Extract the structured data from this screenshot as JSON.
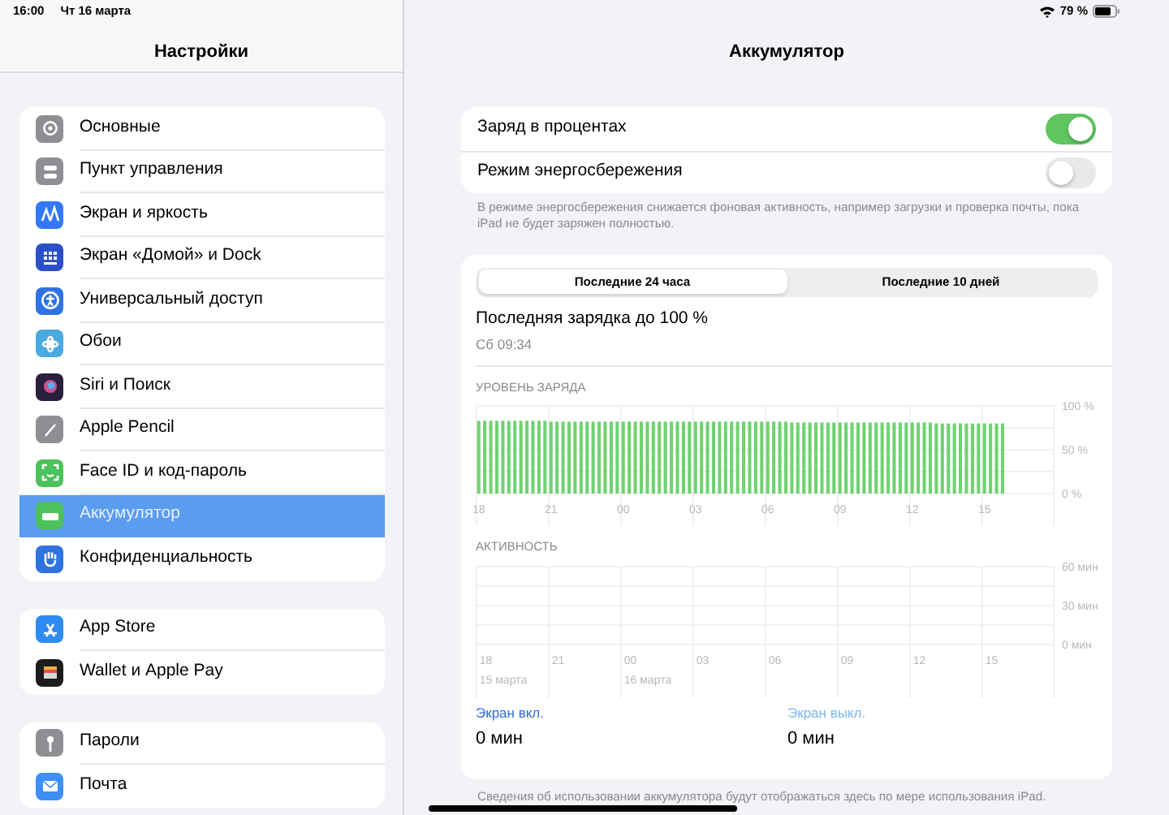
{
  "status_bar": {
    "time": "16:00",
    "date": "Чт 16 марта",
    "battery_percent": "79 %"
  },
  "sidebar": {
    "title": "Настройки",
    "groups": [
      {
        "items": [
          {
            "label": "Основные",
            "color": "#8e8e93",
            "selected": false
          },
          {
            "label": "Пункт управления",
            "color": "#8e8e93",
            "selected": false
          },
          {
            "label": "Экран и яркость",
            "color": "#3478f6",
            "selected": false
          },
          {
            "label": "Экран «Домой» и Dock",
            "color": "#2c4fc9",
            "selected": false
          },
          {
            "label": "Универсальный доступ",
            "color": "#2f73e0",
            "selected": false
          },
          {
            "label": "Обои",
            "color": "#4aa9e0",
            "selected": false
          },
          {
            "label": "Siri и Поиск",
            "color": "#2a1f3d",
            "selected": false
          },
          {
            "label": "Apple Pencil",
            "color": "#8e8e93",
            "selected": false
          },
          {
            "label": "Face ID и код-пароль",
            "color": "#4cc15c",
            "selected": false
          },
          {
            "label": "Аккумулятор",
            "color": "#4cc15c",
            "selected": true
          },
          {
            "label": "Конфиденциальность",
            "color": "#2f73e0",
            "selected": false
          }
        ]
      },
      {
        "items": [
          {
            "label": "App Store",
            "color": "#2f8bf2",
            "selected": false
          },
          {
            "label": "Wallet и Apple Pay",
            "color": "#1c1c1e",
            "selected": false
          }
        ]
      },
      {
        "items": [
          {
            "label": "Пароли",
            "color": "#8e8e93",
            "selected": false
          },
          {
            "label": "Почта",
            "color": "#3d8ef5",
            "selected": false
          }
        ]
      }
    ]
  },
  "detail": {
    "title": "Аккумулятор",
    "toggles": [
      {
        "label": "Заряд в процентах",
        "on": true
      },
      {
        "label": "Режим энергосбережения",
        "on": false
      }
    ],
    "toggles_note": "В режиме энергосбережения снижается фоновая активность, например загрузки и проверка почты, пока iPad не будет заряжен полностью.",
    "segments": [
      {
        "label": "Последние 24 часа",
        "selected": true
      },
      {
        "label": "Последние 10 дней",
        "selected": false
      }
    ],
    "last_charge": {
      "title": "Последняя зарядка до 100 %",
      "time": "Сб 09:34"
    },
    "battery_level": {
      "label": "УРОВЕНЬ ЗАРЯДА",
      "chart_data": {
        "type": "bar",
        "ylim": [
          0,
          100
        ],
        "categories": [
          "18",
          null,
          null,
          null,
          null,
          null,
          null,
          null,
          null,
          null,
          null,
          null,
          "21",
          null,
          null,
          null,
          null,
          null,
          null,
          null,
          null,
          null,
          null,
          null,
          "00",
          null,
          null,
          null,
          null,
          null,
          null,
          null,
          null,
          null,
          null,
          null,
          "03",
          null,
          null,
          null,
          null,
          null,
          null,
          null,
          null,
          null,
          null,
          null,
          "06",
          null,
          null,
          null,
          null,
          null,
          null,
          null,
          null,
          null,
          null,
          null,
          "09",
          null,
          null,
          null,
          null,
          null,
          null,
          null,
          null,
          null,
          null,
          null,
          "12",
          null,
          null,
          null,
          null,
          null,
          null,
          null,
          null,
          null,
          null,
          null,
          "15",
          null,
          null,
          null,
          null,
          null,
          null,
          null,
          null,
          null,
          null,
          null
        ],
        "yticks": [
          {
            "value": 0,
            "label": "0 %"
          },
          {
            "value": 50,
            "label": "50 %"
          },
          {
            "value": 100,
            "label": "100 %"
          }
        ],
        "series": [
          {
            "color": "#6fd36f",
            "values": [
              83,
              83,
              83,
              83,
              83,
              83,
              83,
              83,
              83,
              83,
              83,
              83,
              82,
              82,
              82,
              82,
              82,
              82,
              82,
              82,
              82,
              82,
              82,
              82,
              82,
              82,
              82,
              82,
              82,
              82,
              82,
              82,
              82,
              82,
              82,
              82,
              82,
              82,
              82,
              82,
              82,
              82,
              82,
              82,
              82,
              82,
              82,
              82,
              82,
              82,
              82,
              82,
              81,
              81,
              81,
              81,
              81,
              81,
              81,
              81,
              81,
              81,
              81,
              81,
              81,
              81,
              81,
              81,
              81,
              81,
              81,
              81,
              81,
              81,
              81,
              81,
              80,
              80,
              80,
              80,
              80,
              80,
              80,
              80,
              80,
              80,
              80,
              80,
              null,
              null,
              null,
              null,
              null,
              null,
              null,
              null
            ]
          }
        ]
      }
    },
    "activity": {
      "label": "АКТИВНОСТЬ",
      "chart_data": {
        "type": "bar",
        "ylim": [
          0,
          60
        ],
        "categories": [
          "18",
          "21",
          "00",
          "03",
          "06",
          "09",
          "12",
          "15"
        ],
        "yticks": [
          {
            "value": 0,
            "label": "0 мин"
          },
          {
            "value": 30,
            "label": "30 мин"
          },
          {
            "value": 60,
            "label": "60 мин"
          }
        ],
        "annotations": [
          "15 марта",
          "16 марта"
        ]
      }
    },
    "screen_stats": [
      {
        "label": "Экран вкл.",
        "value": "0 мин",
        "color": "#2f6fd6"
      },
      {
        "label": "Экран выкл.",
        "value": "0 мин",
        "color": "#7ab8f0"
      }
    ],
    "usage_note": "Сведения об использовании аккумулятора будут отображаться здесь по мере использования iPad."
  }
}
